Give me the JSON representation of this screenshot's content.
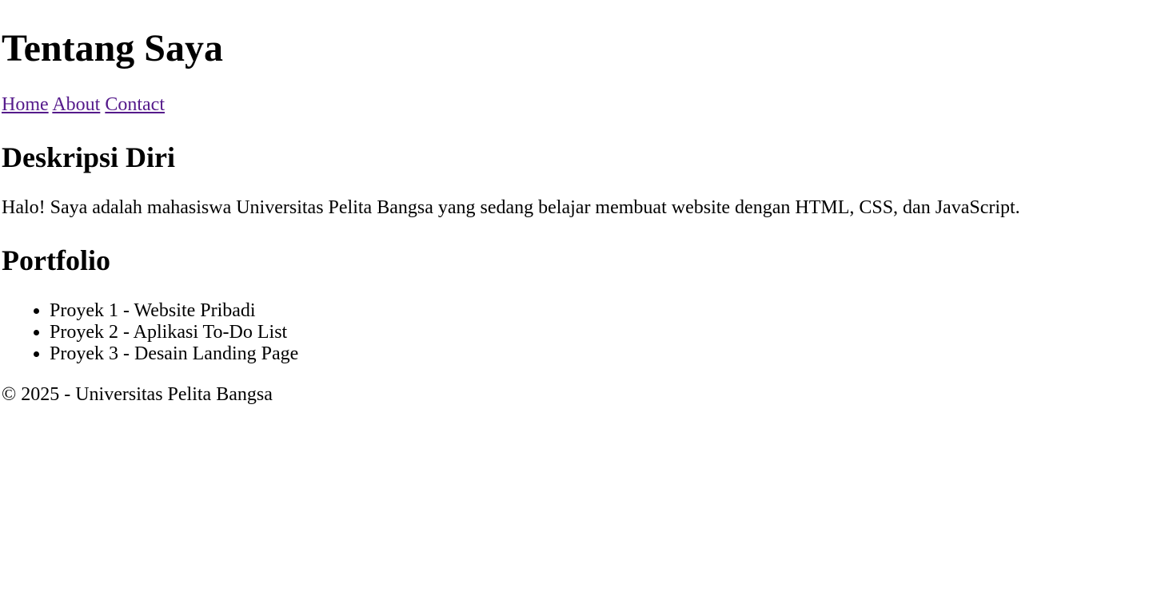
{
  "header": {
    "title": "Tentang Saya"
  },
  "nav": {
    "items": [
      {
        "label": "Home"
      },
      {
        "label": "About"
      },
      {
        "label": "Contact"
      }
    ],
    "link_color": "#551a8b"
  },
  "about": {
    "heading": "Deskripsi Diri",
    "text": "Halo! Saya adalah mahasiswa Universitas Pelita Bangsa yang sedang belajar membuat website dengan HTML, CSS, dan JavaScript."
  },
  "portfolio": {
    "heading": "Portfolio",
    "items": [
      "Proyek 1 - Website Pribadi",
      "Proyek 2 - Aplikasi To-Do List",
      "Proyek 3 - Desain Landing Page"
    ]
  },
  "footer": {
    "text": "© 2025 - Universitas Pelita Bangsa"
  }
}
